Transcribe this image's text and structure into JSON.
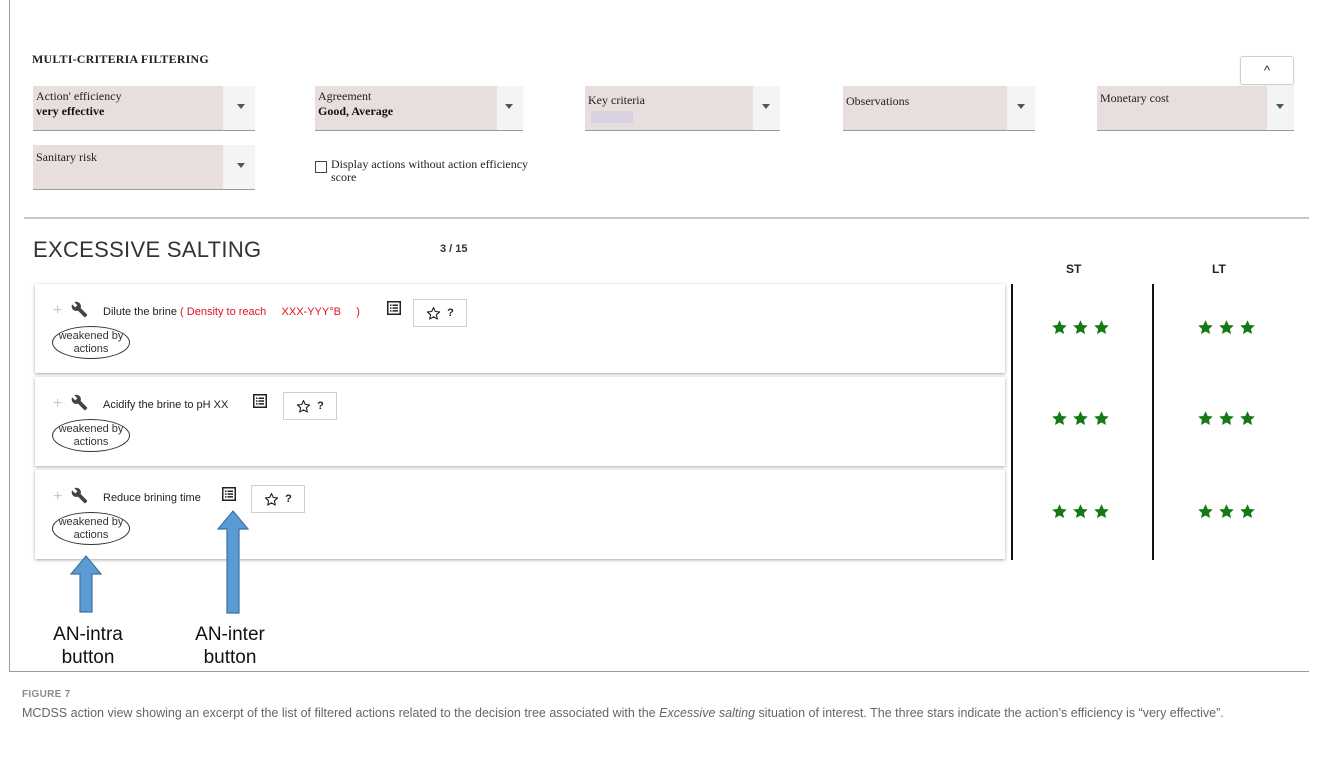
{
  "filter_panel": {
    "title": "MULTI-CRITERIA FILTERING",
    "collapse_icon": "^",
    "filters": [
      {
        "label": "Action' efficiency",
        "value": "very effective"
      },
      {
        "label": "Agreement",
        "value": "Good, Average"
      },
      {
        "label": "Key criteria",
        "value": ""
      },
      {
        "label": "Observations",
        "value": ""
      },
      {
        "label": "Monetary cost",
        "value": ""
      },
      {
        "label": "Sanitary risk",
        "value": ""
      }
    ],
    "checkbox_label": "Display actions without action efficiency score"
  },
  "section": {
    "title": "EXCESSIVE SALTING",
    "counter": "3 / 15",
    "col_st": "ST",
    "col_lt": "LT"
  },
  "actions": [
    {
      "name": "Dilute the brine",
      "note": " ( Density to reach     XXX-YYY°B     )",
      "favorite_label": "?",
      "weakened_line1": "weakened by",
      "weakened_line2": "actions",
      "st_stars": 3,
      "lt_stars": 3
    },
    {
      "name": "Acidify the brine to pH XX",
      "note": "",
      "favorite_label": "?",
      "weakened_line1": "weakened by",
      "weakened_line2": "actions",
      "st_stars": 3,
      "lt_stars": 3
    },
    {
      "name": "Reduce brining time",
      "note": "",
      "favorite_label": "?",
      "weakened_line1": "weakened by",
      "weakened_line2": "actions",
      "st_stars": 3,
      "lt_stars": 3
    }
  ],
  "annotations": {
    "intra": {
      "line1": "AN-intra",
      "line2": "button"
    },
    "inter": {
      "line1": "AN-inter",
      "line2": "button"
    }
  },
  "figure": {
    "label": "FIGURE 7",
    "caption_start": "MCDSS action view showing an excerpt of the list of filtered actions related to the decision tree associated with the ",
    "caption_italic": "Excessive salting",
    "caption_end": " situation of interest. The three stars indicate the action’s efficiency is “very effective”."
  },
  "colors": {
    "filter_bg": "#e8dede",
    "note_red": "#e0141e",
    "star_green": "#157a15",
    "arrow_blue": "#5b9bd5",
    "arrow_border": "#41719c"
  },
  "icons": [
    "chevron-up-icon",
    "dropdown-caret-icon",
    "plus-icon",
    "wrench-icon",
    "list-icon",
    "star-outline-icon",
    "star-filled-icon",
    "arrow-up-icon"
  ]
}
